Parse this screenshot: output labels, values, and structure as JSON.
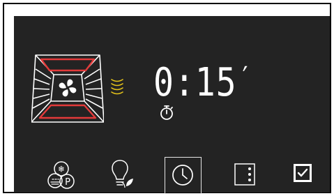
{
  "timer": {
    "minutes": "0",
    "separator": ":",
    "seconds": "15",
    "unit_mark": "′"
  },
  "mode_icon": {
    "labels": {
      "top": "❄",
      "bottom_right": "P"
    }
  },
  "colors": {
    "screen_bg": "#232323",
    "heating_element": "#e33a3a",
    "wave": "#e6c419",
    "icon": "#ffffff"
  },
  "icons": {
    "cavity": "oven-cavity-fan-icon",
    "waves": "steam-waves-icon",
    "stopwatch": "stopwatch-icon",
    "mode": "defrost-proof-mode-icon",
    "light": "lamp-eco-icon",
    "timer": "clock-icon",
    "menu": "vertical-dots-icon",
    "confirm": "checkmark-icon"
  }
}
